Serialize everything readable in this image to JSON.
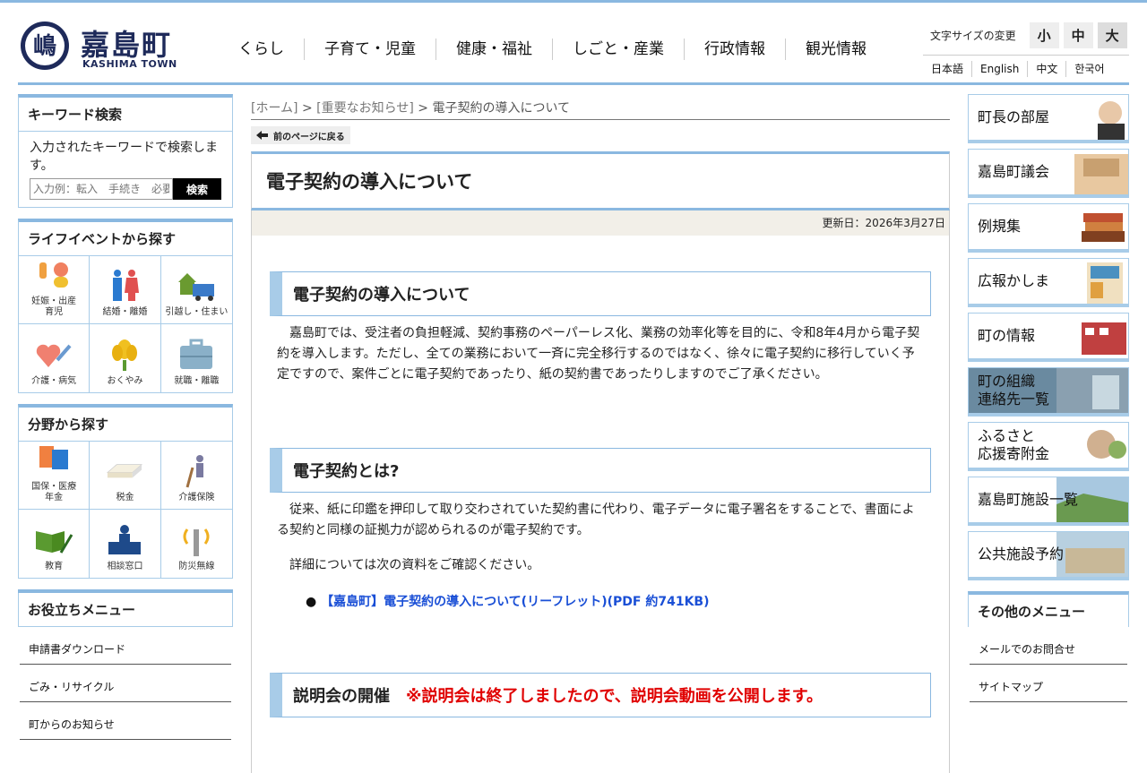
{
  "header": {
    "logo_glyph": "嶋",
    "site_name": "嘉島町",
    "site_name_en": "KASHIMA TOWN",
    "nav": [
      "くらし",
      "子育て・児童",
      "健康・福祉",
      "しごと・産業",
      "行政情報",
      "観光情報"
    ],
    "font_size_label": "文字サイズの変更",
    "font_sizes": [
      "小",
      "中",
      "大"
    ],
    "languages": [
      "日本語",
      "English",
      "中文",
      "한국어"
    ]
  },
  "left": {
    "keyword": {
      "title": "キーワード検索",
      "desc": "入力されたキーワードで検索します。",
      "placeholder": "入力例：転入　手続き　必要",
      "button": "検索"
    },
    "lifeevent": {
      "title": "ライフイベントから探す",
      "items": [
        {
          "label": "妊娠・出産\n育児",
          "icon": "pregnancy-icon"
        },
        {
          "label": "結婚・離婚",
          "icon": "couple-icon"
        },
        {
          "label": "引越し・住まい",
          "icon": "moving-icon"
        },
        {
          "label": "介護・病気",
          "icon": "care-icon"
        },
        {
          "label": "おくやみ",
          "icon": "flower-icon"
        },
        {
          "label": "就職・離職",
          "icon": "briefcase-icon"
        }
      ]
    },
    "field": {
      "title": "分野から探す",
      "items": [
        {
          "label": "国保・医療\n年金",
          "icon": "health-insurance-icon"
        },
        {
          "label": "税金",
          "icon": "tax-icon"
        },
        {
          "label": "介護保険",
          "icon": "nursing-icon"
        },
        {
          "label": "教育",
          "icon": "education-icon"
        },
        {
          "label": "相談窓口",
          "icon": "consult-icon"
        },
        {
          "label": "防災無線",
          "icon": "radio-icon"
        }
      ]
    },
    "useful": {
      "title": "お役立ちメニュー",
      "items": [
        "申請書ダウンロード",
        "ごみ・リサイクル",
        "町からのお知らせ"
      ]
    }
  },
  "main": {
    "breadcrumb": {
      "home": "[ホーム]",
      "sep": ">",
      "parent": "[重要なお知らせ]",
      "current": "電子契約の導入について"
    },
    "back": "前のページに戻る",
    "title": "電子契約の導入について",
    "updated": "更新日：2026年3月27日",
    "s1": {
      "heading": "電子契約の導入について",
      "text": "嘉島町では、受注者の負担軽減、契約事務のペーパーレス化、業務の効率化等を目的に、令和8年4月から電子契約を導入します。ただし、全ての業務において一斉に完全移行するのではなく、徐々に電子契約に移行していく予定ですので、案件ごとに電子契約であったり、紙の契約書であったりしますのでご了承ください。"
    },
    "s2": {
      "heading": "電子契約とは?",
      "text1": "従来、紙に印鑑を押印して取り交わされていた契約書に代わり、電子データに電子署名をすることで、書面による契約と同様の証拠力が認められるのが電子契約です。",
      "text2": "詳細については次の資料をご確認ください。",
      "link": "【嘉島町】電子契約の導入について(リーフレット)(PDF 約741KB)"
    },
    "s3": {
      "heading": "説明会の開催",
      "notice": "※説明会は終了しましたので、説明会動画を公開します。"
    }
  },
  "right": {
    "banners": [
      "町長の部屋",
      "嘉島町議会",
      "例規集",
      "広報かしま",
      "町の情報",
      "町の組織\n連絡先一覧",
      "ふるさと\n応援寄附金",
      "嘉島町施設一覧",
      "公共施設予約"
    ],
    "other": {
      "title": "その他のメニュー",
      "items": [
        "メールでのお問合せ",
        "サイトマップ"
      ]
    }
  }
}
